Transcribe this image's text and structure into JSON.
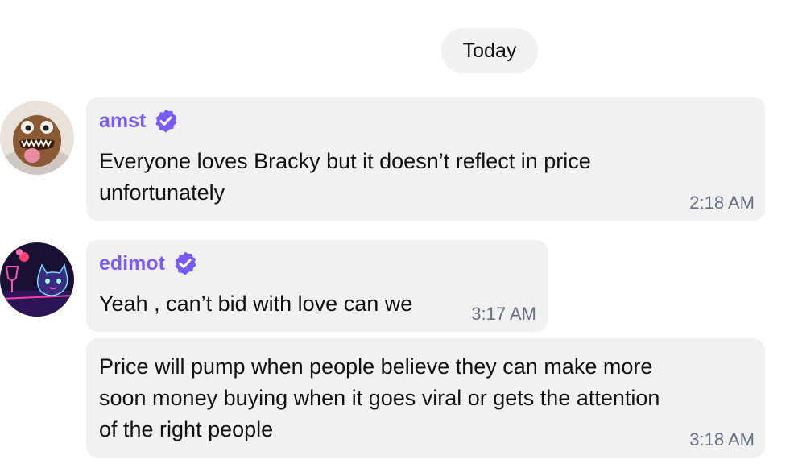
{
  "chat": {
    "date_label": "Today",
    "messages": [
      {
        "sender": "amst",
        "verified": true,
        "avatar_icon": "creature-avatar-icon",
        "lines": [
          "Everyone loves Bracky but it doesn’t reflect in price",
          "unfortunately"
        ],
        "time": "2:18 AM"
      },
      {
        "sender": "edimot",
        "verified": true,
        "avatar_icon": "neon-cat-avatar-icon",
        "lines": [
          "Yeah , can’t bid with love can we"
        ],
        "time": "3:17 AM"
      },
      {
        "sender": "",
        "lines": [
          "Price will pump when people believe they can make more",
          "soon money buying when it goes viral or gets the attention",
          "of the right people"
        ],
        "time": "3:18 AM"
      }
    ]
  },
  "colors": {
    "sender_name": "#7a5af8",
    "verified_badge": "#7a5af8",
    "bubble_bg": "#f1f1f1",
    "timestamp": "#667085",
    "message_text": "#111111"
  }
}
